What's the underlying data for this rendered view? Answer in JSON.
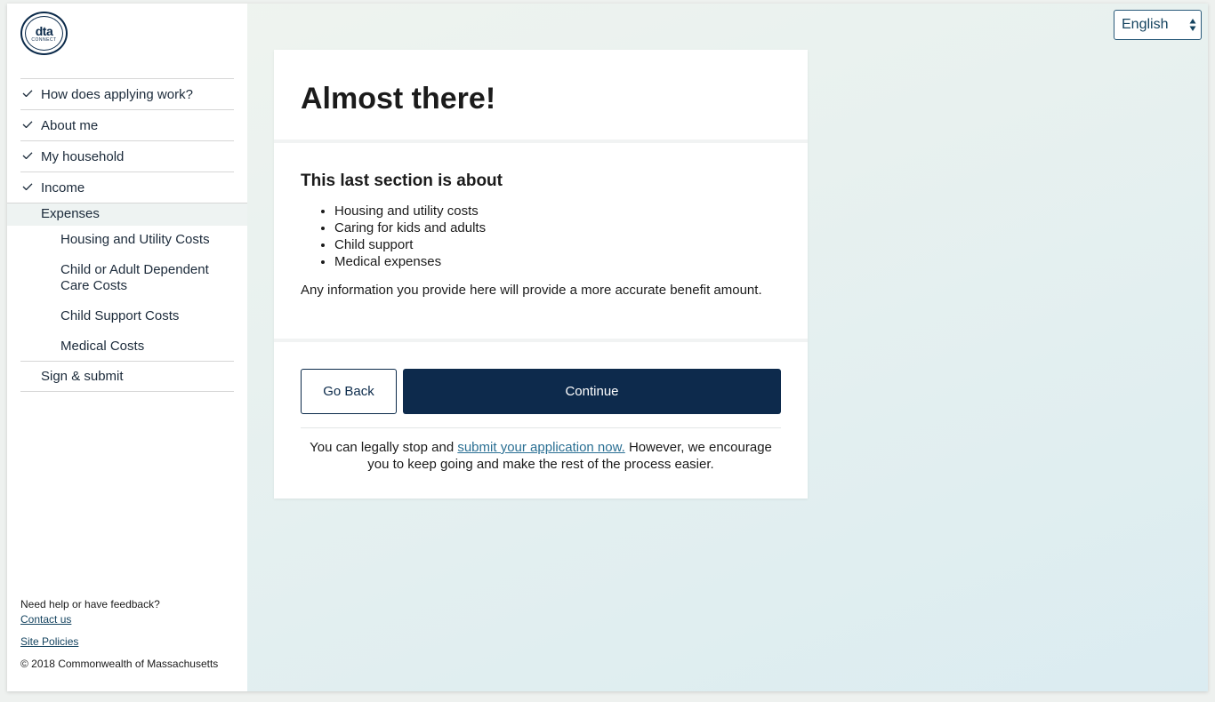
{
  "brand": {
    "logo_main": "dta",
    "logo_sub": "CONNECT"
  },
  "sidebar": {
    "items": [
      {
        "label": "How does applying work?",
        "completed": true
      },
      {
        "label": "About me",
        "completed": true
      },
      {
        "label": "My household",
        "completed": true
      },
      {
        "label": "Income",
        "completed": true
      }
    ],
    "active_section": "Expenses",
    "sub_items": [
      "Housing and Utility Costs",
      "Child or Adult Dependent Care Costs",
      "Child Support Costs",
      "Medical Costs"
    ],
    "last_item": "Sign & submit"
  },
  "footer": {
    "help_text": "Need help or have feedback?",
    "contact_link": "Contact us",
    "policies_link": "Site Policies",
    "copyright": "© 2018 Commonwealth of Massachusetts"
  },
  "language": {
    "selected": "English"
  },
  "main": {
    "title": "Almost there!",
    "section_heading": "This last section is about",
    "bullets": [
      "Housing and utility costs",
      "Caring for kids and adults",
      "Child support",
      "Medical expenses"
    ],
    "info_text": "Any information you provide here will provide a more accurate benefit amount.",
    "back_label": "Go Back",
    "continue_label": "Continue",
    "note_prefix": "You can legally stop and ",
    "note_link": "submit your application now.",
    "note_suffix": " However, we encourage you to keep going and make the rest of the process easier."
  },
  "colors": {
    "primary": "#0d2a4c",
    "link": "#2a6f93",
    "background": "#e8f1ef"
  }
}
